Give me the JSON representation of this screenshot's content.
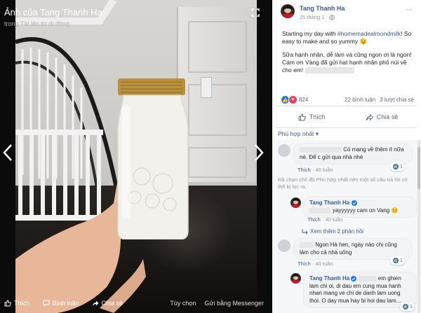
{
  "viewer": {
    "album_title": "Ảnh của Tang Thanh Ha",
    "album_subtitle": "trong Tải lên từ di động",
    "bottom_actions": [
      "Thích",
      "Bình luận",
      "Chia sẻ"
    ],
    "right_actions": [
      "Tùy chọn",
      "Gửi bằng Messenger"
    ]
  },
  "post": {
    "author": "Tang Thanh Ha",
    "date": "25 tháng 1",
    "text_1_pre": "Starting my day with ",
    "hashtag": "#homemadealmondmilk",
    "text_1_post": "! So easy to make and so yummy 😉",
    "text_2": "Sữa hạnh nhân, dễ làm và cũng ngon ơi là ngon! Cám ơn Vàng đã gửi hạt hạnh nhân phố núi về cho em!",
    "reaction_count": "824",
    "comment_count": "22 bình luận",
    "share_count": "3 lượt chia sẻ",
    "like_label": "Thích",
    "share_label": "Chia sẻ",
    "sort_label": "Phù hợp nhất ▾"
  },
  "comments": [
    {
      "text": "Có mạng về thêm ít nữa nè. Để c gửi qua nhà nhé",
      "like_action": "Thích",
      "time": "40 tuần",
      "likes": "1"
    },
    {
      "notice": "Đã chọn chế độ Phù hợp nhất nên một số câu trả lời có thể bị lọc ra."
    },
    {
      "author": "Tang Thanh Ha",
      "text": "yayyyyyy cam on Vang 😊",
      "like_action": "Thích",
      "time": "40 tuần",
      "more_replies": "Xem thêm 2 phản hồi"
    },
    {
      "text": "Ngon Hà hen, ngày nào chị cũng làm cho cả nhà uống",
      "like_action": "Thích",
      "time": "40 tuần",
      "likes": "1"
    },
    {
      "author": "Tang Thanh Ha",
      "text": "em ghien lam chi oi, di dau em cung mua hanh nhan mang ve chi de danh lam uong thoi. O day mua hay bi hoi dau lam...",
      "likes": "1"
    }
  ],
  "colors": {
    "link": "#365899",
    "like_blue": "#1877f2",
    "love_red": "#f33e58",
    "panel_bg": "#ffffff"
  }
}
